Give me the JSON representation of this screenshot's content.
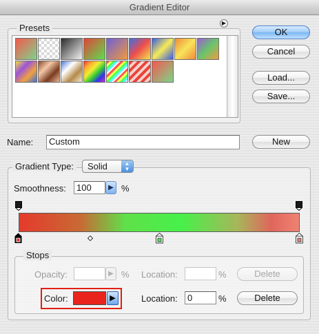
{
  "window": {
    "title": "Gradient Editor"
  },
  "presets": {
    "label": "Presets",
    "swatches": [
      {
        "name": "foreground-to-background",
        "bg": "linear-gradient(135deg,#f35a4f,#7fd38a)"
      },
      {
        "name": "foreground-to-transparent",
        "bg": "repeating-conic-gradient(#ffffff 0% 25%, #d9d9d9 0% 50%) 0 0/8px 8px"
      },
      {
        "name": "black-white",
        "bg": "linear-gradient(135deg,#2b2b2b,#f2f2f2)"
      },
      {
        "name": "red-green",
        "bg": "linear-gradient(135deg,#e0443a,#5fdc4f)"
      },
      {
        "name": "violet-orange",
        "bg": "linear-gradient(135deg,#6f5fd6,#f09a3e)"
      },
      {
        "name": "blue-red-yellow",
        "bg": "linear-gradient(135deg,#3c6fe0,#ee4d4d,#f4e24b)"
      },
      {
        "name": "blue-yellow-blue",
        "bg": "linear-gradient(135deg,#3b5be6,#f6ea58,#3b5be6)"
      },
      {
        "name": "orange-yellow-orange",
        "bg": "linear-gradient(135deg,#ef8a3a,#f8e45a,#ef8a3a)"
      },
      {
        "name": "violet-green-orange",
        "bg": "linear-gradient(135deg,#9a5fd0,#69c56b,#f09a3e)"
      },
      {
        "name": "yellow-violet-orange-blue",
        "bg": "linear-gradient(135deg,#f4dd44,#9b55d8,#f0a13e,#3c6fe0)"
      },
      {
        "name": "copper",
        "bg": "linear-gradient(135deg,#8a4c2c,#f4c7a7,#7a3c20,#e8b494)"
      },
      {
        "name": "chrome",
        "bg": "linear-gradient(135deg,#4a78d8,#ffffff,#b58a4a,#f4e8d0)"
      },
      {
        "name": "spectrum",
        "bg": "linear-gradient(135deg,#e33,#fa3,#ee3,#3c3,#33e,#c3c)"
      },
      {
        "name": "transparent-rainbow",
        "bg": "repeating-linear-gradient(135deg,#f55 0 3px,#ff5 3px 6px,#5f5 6px 9px,#5ff 9px 12px,#fff 12px 14px)"
      },
      {
        "name": "transparent-stripes",
        "bg": "repeating-linear-gradient(135deg,#e8443a 0 4px,#f7d1cc 4px 8px)"
      },
      {
        "name": "red-green-custom",
        "bg": "linear-gradient(135deg,#f35a4f,#7fd38a)"
      }
    ]
  },
  "buttons": {
    "ok": "OK",
    "cancel": "Cancel",
    "load": "Load...",
    "save": "Save...",
    "new": "New"
  },
  "name_field": {
    "label": "Name:",
    "value": "Custom"
  },
  "gradient_type": {
    "label": "Gradient Type:",
    "value": "Solid"
  },
  "smoothness": {
    "label": "Smoothness:",
    "value": "100",
    "unit": "%"
  },
  "gradient": {
    "css": "linear-gradient(90deg,#e53a2c 0%,#c86a34 22%,#5fe14a 38%,#47f04a 58%,#a7b65a 78%,#e0665c 90%,#ee8373 100%)",
    "midpoint_percent": 25.5
  },
  "stops": {
    "label": "Stops",
    "opacity_label": "Opacity:",
    "opacity_value": "",
    "opacity_unit": "%",
    "location_label": "Location:",
    "opacity_location_value": "",
    "location_unit": "%",
    "delete_label": "Delete",
    "color_label": "Color:",
    "color_value": "#e8241d",
    "color_location_value": "0"
  },
  "colors": {
    "accent": "#e22a20",
    "highlight": "#e01e12"
  }
}
